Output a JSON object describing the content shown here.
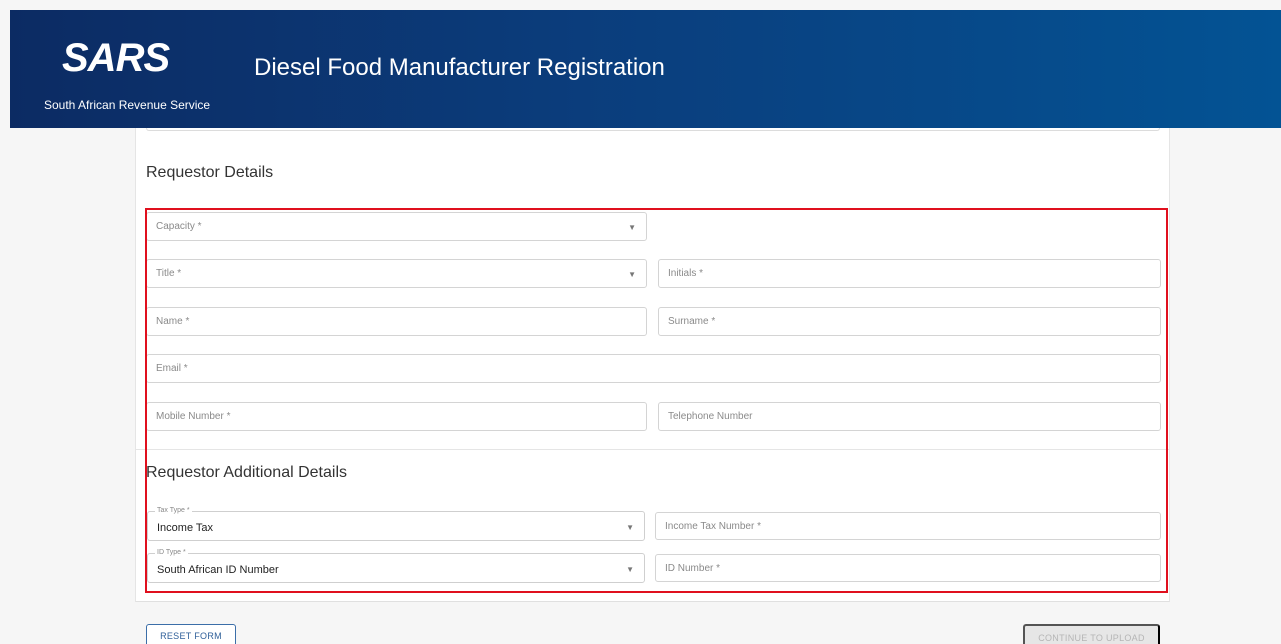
{
  "header": {
    "logo_text": "SARS",
    "logo_subtitle": "South African Revenue Service",
    "title": "Diesel Food Manufacturer Registration"
  },
  "requestor_details": {
    "heading": "Requestor Details",
    "capacity": {
      "placeholder": "Capacity *"
    },
    "title": {
      "placeholder": "Title *"
    },
    "initials": {
      "placeholder": "Initials *"
    },
    "name": {
      "placeholder": "Name *"
    },
    "surname": {
      "placeholder": "Surname *"
    },
    "email": {
      "placeholder": "Email *"
    },
    "mobile": {
      "placeholder": "Mobile Number *"
    },
    "telephone": {
      "placeholder": "Telephone Number"
    }
  },
  "additional_details": {
    "heading": "Requestor Additional Details",
    "tax_type": {
      "label": "Tax Type *",
      "value": "Income Tax"
    },
    "income_tax_number": {
      "placeholder": "Income Tax Number *"
    },
    "id_type": {
      "label": "ID Type *",
      "value": "South African ID Number"
    },
    "id_number": {
      "placeholder": "ID Number *"
    }
  },
  "actions": {
    "reset_label": "RESET FORM",
    "continue_label": "CONTINUE TO UPLOAD"
  },
  "icons": {
    "dropdown": "chevron-down-icon"
  },
  "colors": {
    "header_start": "#0c2b63",
    "header_end": "#035394",
    "highlight": "#e0101e",
    "reset_text": "#2f5f99"
  }
}
